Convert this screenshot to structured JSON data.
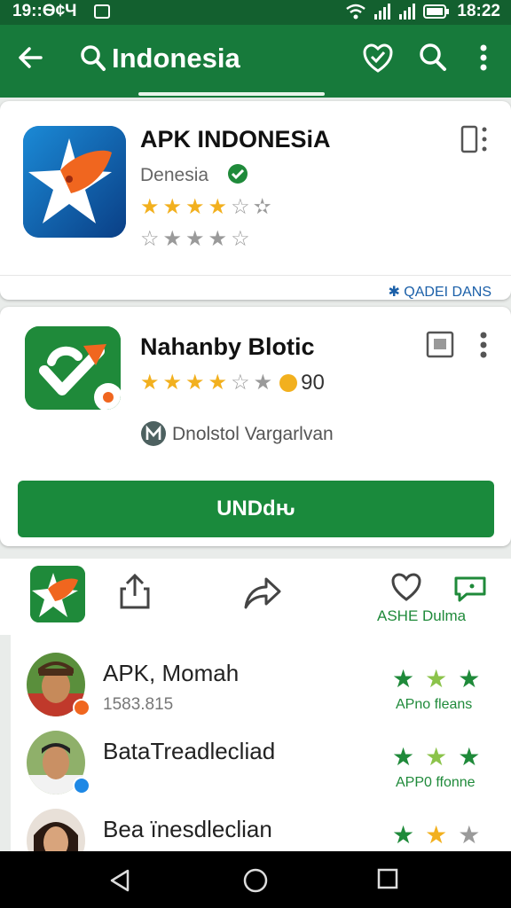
{
  "status_bar": {
    "time_left": "19::Ѳ¢Ч",
    "time_right": "18:22"
  },
  "app_bar": {
    "title": "Indonesia"
  },
  "cards": [
    {
      "title": "APK INDONESiA",
      "developer": "Denesia",
      "footer_link": "✱ QADEI DANS"
    },
    {
      "title": "Nahanby Blotic",
      "rating_count": "90",
      "publisher": "Dnolstol Vargarlvan",
      "install_label": "UNDԁԋ"
    }
  ],
  "action_row": {
    "caption": "ASHE Dulma"
  },
  "list": [
    {
      "name": "APK, Momah",
      "sub": "1583.815",
      "caption": "APno ﬂeans"
    },
    {
      "name": "BataTreadlecliad",
      "sub": "",
      "caption": "APP0 ffonne"
    },
    {
      "name": "Bea ïnesdleclian",
      "sub": "",
      "caption": ""
    }
  ],
  "colors": {
    "primary": "#177a3b",
    "status": "#13602f",
    "install": "#1a8a3c",
    "star_gold": "#f2b01e"
  },
  "icons": [
    "back-arrow-icon",
    "search-icon",
    "heart-shield-icon",
    "more-vert-icon",
    "share-icon",
    "forward-icon",
    "heart-icon",
    "chat-icon",
    "home-icon"
  ]
}
